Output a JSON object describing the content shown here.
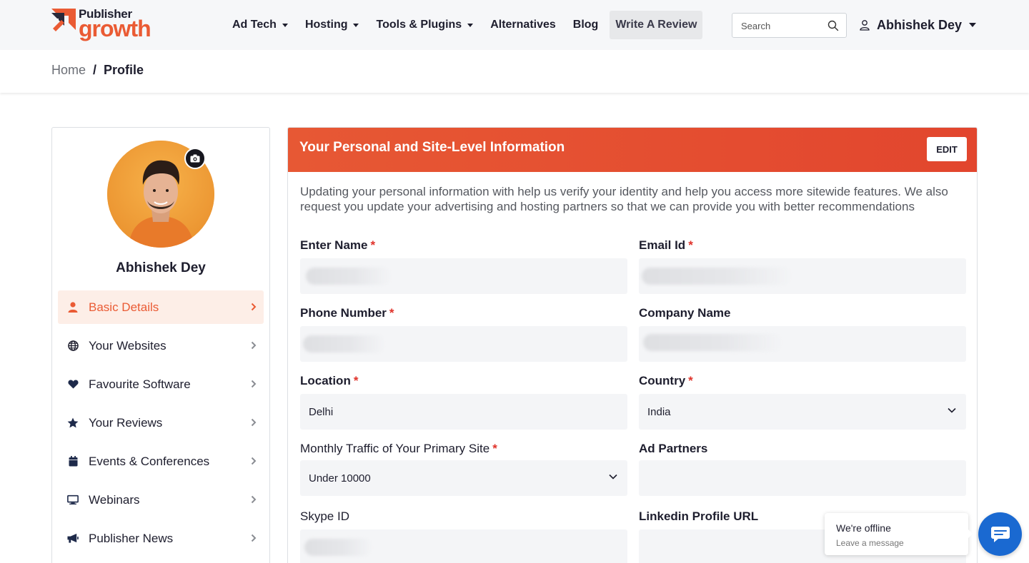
{
  "brand": {
    "name_top": "Publisher",
    "name_bottom": "growth",
    "accent_color": "#ea5b34"
  },
  "nav": {
    "items": [
      {
        "label": "Ad Tech",
        "has_dropdown": true
      },
      {
        "label": "Hosting",
        "has_dropdown": true
      },
      {
        "label": "Tools & Plugins",
        "has_dropdown": true
      },
      {
        "label": "Alternatives",
        "has_dropdown": false
      },
      {
        "label": "Blog",
        "has_dropdown": false
      }
    ],
    "cta_label": "Write A Review",
    "search_placeholder": "Search",
    "search_icon": "search-icon",
    "user_icon": "user-icon",
    "user_name": "Abhishek Dey"
  },
  "breadcrumb": {
    "home": "Home",
    "separator": "/",
    "current": "Profile"
  },
  "sidebar": {
    "profile_name": "Abhishek Dey",
    "camera_icon": "camera-icon",
    "items": [
      {
        "label": "Basic Details",
        "icon": "user-icon",
        "active": true
      },
      {
        "label": "Your Websites",
        "icon": "globe-icon",
        "active": false
      },
      {
        "label": "Favourite Software",
        "icon": "heart-icon",
        "active": false
      },
      {
        "label": "Your Reviews",
        "icon": "star-icon",
        "active": false
      },
      {
        "label": "Events & Conferences",
        "icon": "calendar-icon",
        "active": false
      },
      {
        "label": "Webinars",
        "icon": "monitor-icon",
        "active": false
      },
      {
        "label": "Publisher News",
        "icon": "megaphone-icon",
        "active": false
      }
    ]
  },
  "panel": {
    "title": "Your Personal and Site-Level Information",
    "edit_label": "EDIT",
    "description": "Updating your personal information with help us verify your identity and help you access more sitewide features. We also request you update your advertising and hosting partners so that we can provide you with better recommendations",
    "fields": {
      "name": {
        "label": "Enter Name",
        "required": "*",
        "value": ""
      },
      "email": {
        "label": "Email Id",
        "required": "*",
        "value": ""
      },
      "phone": {
        "label": "Phone Number",
        "required": "*",
        "value": ""
      },
      "company": {
        "label": "Company Name",
        "value": ""
      },
      "location": {
        "label": "Location",
        "required": "*",
        "value": "Delhi"
      },
      "country": {
        "label": "Country",
        "required": "*",
        "value": "India"
      },
      "traffic": {
        "label": "Monthly Traffic of Your Primary Site",
        "required": "*",
        "value": "Under 10000"
      },
      "ad_partners": {
        "label": "Ad Partners",
        "value": ""
      },
      "skype": {
        "label": "Skype ID",
        "value": ""
      },
      "linkedin": {
        "label": "Linkedin Profile URL",
        "value": ""
      }
    }
  },
  "chat": {
    "status": "We're offline",
    "action": "Leave a message",
    "icon": "chat-icon",
    "color": "#1a69d1"
  }
}
